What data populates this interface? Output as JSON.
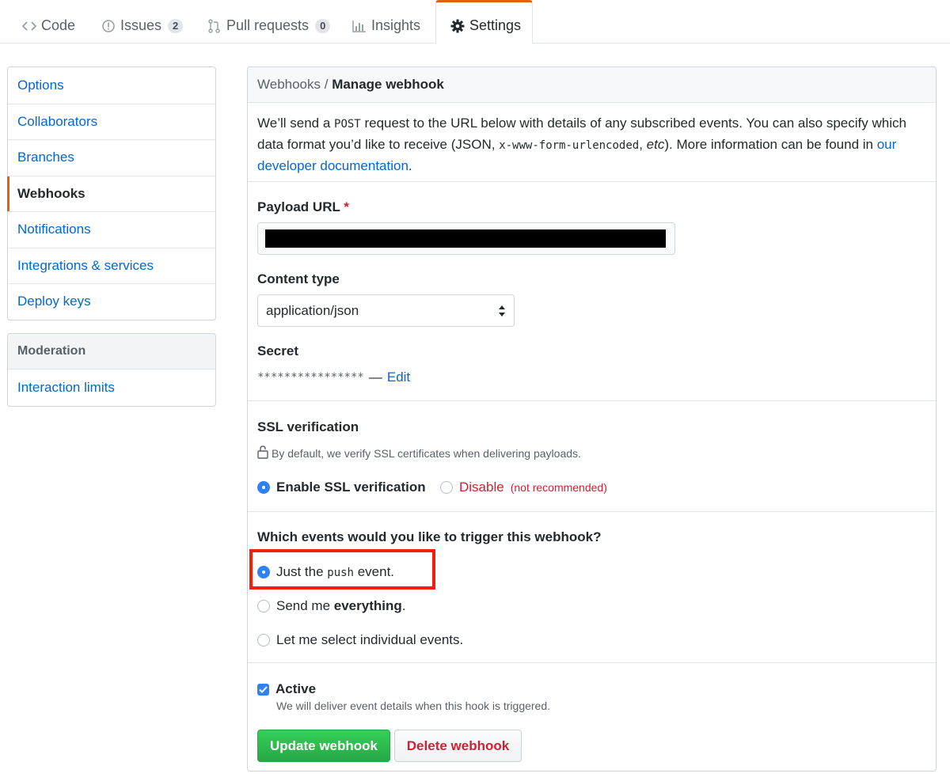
{
  "tabs": [
    {
      "label": "Code",
      "icon": "code-icon"
    },
    {
      "label": "Issues",
      "count": "2",
      "icon": "issue-icon"
    },
    {
      "label": "Pull requests",
      "count": "0",
      "icon": "pull-request-icon"
    },
    {
      "label": "Insights",
      "icon": "graph-icon"
    },
    {
      "label": "Settings",
      "icon": "gear-icon",
      "selected": true
    }
  ],
  "sidebar": {
    "items": [
      "Options",
      "Collaborators",
      "Branches",
      "Webhooks",
      "Notifications",
      "Integrations & services",
      "Deploy keys"
    ],
    "selected": "Webhooks",
    "moderation": {
      "heading": "Moderation",
      "items": [
        "Interaction limits"
      ]
    }
  },
  "header": {
    "crumb": "Webhooks",
    "separator": " / ",
    "title": "Manage webhook"
  },
  "intro": {
    "t1": "We’ll send a ",
    "code1": "POST",
    "t2": " request to the URL below with details of any subscribed events. You can also specify which data format you’d like to receive (JSON, ",
    "code2": "x-www-form-urlencoded",
    "t3": ", ",
    "em": "etc",
    "t4": "). More information can be found in ",
    "link": "our developer documentation",
    "t5": "."
  },
  "payload": {
    "label": "Payload URL",
    "required": "*",
    "value": "[redacted]"
  },
  "content_type": {
    "label": "Content type",
    "value": "application/json"
  },
  "secret": {
    "label": "Secret",
    "value": "****************",
    "dash": "—",
    "edit": "Edit"
  },
  "ssl": {
    "label": "SSL verification",
    "note": "By default, we verify SSL certificates when delivering payloads.",
    "enable": "Enable SSL verification",
    "disable": "Disable",
    "disable_note": "(not recommended)",
    "selected": "enable"
  },
  "events": {
    "question": "Which events would you like to trigger this webhook?",
    "opt1_pre": "Just the ",
    "opt1_code": "push",
    "opt1_post": " event.",
    "opt2_pre": "Send me ",
    "opt2_bold": "everything",
    "opt2_post": ".",
    "opt3": "Let me select individual events.",
    "selected": "push"
  },
  "active": {
    "label": "Active",
    "note": "We will deliver event details when this hook is triggered.",
    "checked": true
  },
  "buttons": {
    "update": "Update webhook",
    "delete": "Delete webhook"
  },
  "colors": {
    "accent": "#e36209",
    "link": "#0366d6",
    "danger": "#cb2431",
    "success": "#28a745",
    "highlight": "#f0200a"
  }
}
